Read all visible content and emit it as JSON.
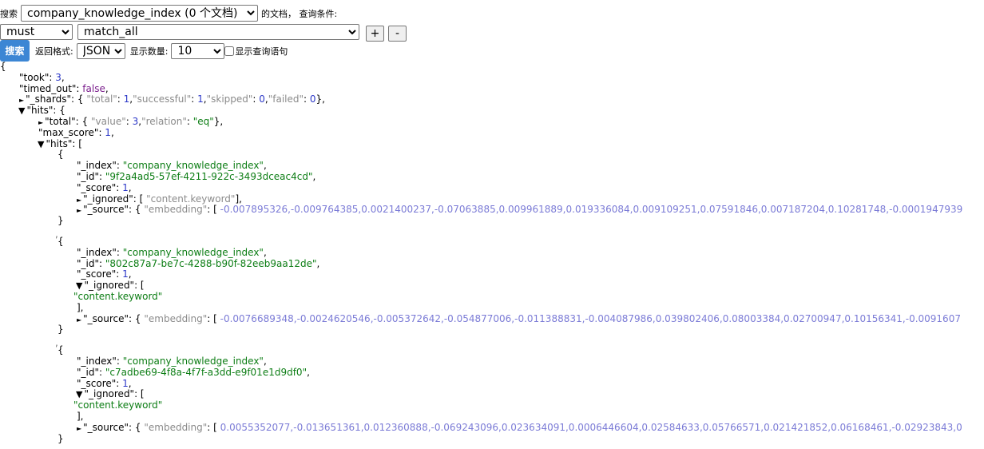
{
  "query_bar": {
    "search_label": "搜索",
    "index_selected": "company_knowledge_index (0 个文档)",
    "docs_label": "的文档，  查询条件:",
    "bool_selected": "must",
    "query_selected": "match_all",
    "add_label": "+",
    "remove_label": "-"
  },
  "controls": {
    "search_button": "搜索",
    "format_label": "返回格式:",
    "format_selected": "JSON",
    "count_label": "显示数量:",
    "count_selected": "10",
    "show_query_label": "显示查询语句"
  },
  "icons": {
    "collapsed": "►",
    "expanded": "▼"
  },
  "colors": {
    "number": "#2d39c8",
    "boolean": "#7a1e8c",
    "string": "#0c7d14",
    "muted": "#8b8b8b",
    "vector": "#7b7bd6",
    "button": "#3c86d4"
  },
  "result": {
    "took": 3,
    "timed_out": "false",
    "shards": {
      "total": 1,
      "successful": 1,
      "skipped": 0,
      "failed": 0
    },
    "hits_total": {
      "value": 3,
      "relation": "\"eq\""
    },
    "max_score": 1,
    "hits": [
      {
        "index": "\"company_knowledge_index\"",
        "id": "\"9f2a4ad5-57ef-4211-922c-3493dceac4cd\"",
        "score": 1,
        "ignored": "\"content.keyword\"",
        "ignored_expanded": false,
        "embedding": "-0.007895326,-0.009764385,0.0021400237,-0.07063885,0.009961889,0.019336084,0.009109251,0.07591846,0.007187204,0.10281748,-0.0001947939"
      },
      {
        "index": "\"company_knowledge_index\"",
        "id": "\"802c87a7-be7c-4288-b90f-82eeb9aa12de\"",
        "score": 1,
        "ignored": "\"content.keyword\"",
        "ignored_expanded": true,
        "embedding": "-0.0076689348,-0.0024620546,-0.005372642,-0.054877006,-0.011388831,-0.004087986,0.039802406,0.08003384,0.02700947,0.10156341,-0.0091607"
      },
      {
        "index": "\"company_knowledge_index\"",
        "id": "\"c7adbe69-4f8a-4f7f-a3dd-e9f01e1d9df0\"",
        "score": 1,
        "ignored": "\"content.keyword\"",
        "ignored_expanded": true,
        "embedding": "0.0055352077,-0.013651361,0.012360888,-0.069243096,0.023634091,0.0006446604,0.02584633,0.05766571,0.021421852,0.06168461,-0.02923843,0"
      }
    ]
  }
}
